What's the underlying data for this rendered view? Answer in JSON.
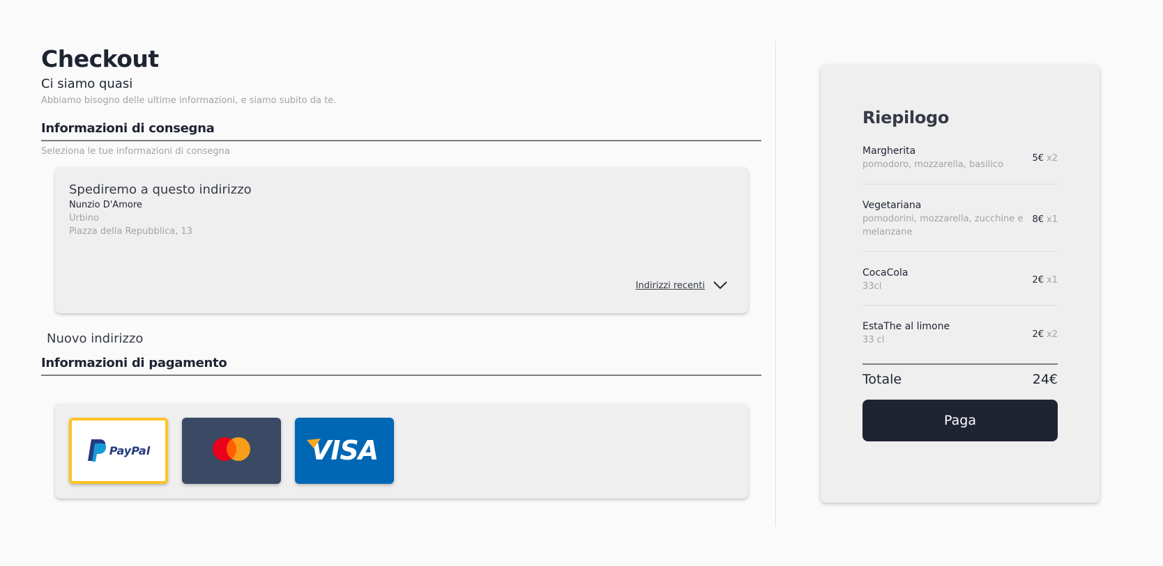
{
  "checkout": {
    "title": "Checkout",
    "subtitle": "Ci siamo quasi",
    "description": "Abbiamo bisogno delle ultime informazioni, e siamo subito da te."
  },
  "delivery": {
    "section_title": "Informazioni di consegna",
    "hint": "Seleziona le tue informazioni di consegna",
    "card_heading": "Spediremo a questo indirizzo",
    "name": "Nunzio D'Amore",
    "city": "Urbino",
    "street": "Piazza della Repubblica, 13",
    "recent_label": "Indirizzi recenti",
    "recent_icon": "chevron-down-icon",
    "new_address_label": "Nuovo indirizzo"
  },
  "payment": {
    "section_title": "Informazioni di pagamento",
    "methods": [
      {
        "id": "paypal",
        "icon": "paypal-logo-icon",
        "label": "PayPal",
        "selected": true
      },
      {
        "id": "mastercard",
        "icon": "mastercard-logo-icon",
        "label": "",
        "selected": false
      },
      {
        "id": "visa",
        "icon": "visa-logo-icon",
        "label": "VISA",
        "selected": false
      }
    ]
  },
  "summary": {
    "title": "Riepilogo",
    "items": [
      {
        "name": "Margherita",
        "desc": "pomodoro, mozzarella, basilico",
        "price": "5€",
        "qty": "x2"
      },
      {
        "name": "Vegetariana",
        "desc": "pomodorini, mozzarella, zucchine e melanzane",
        "price": "8€",
        "qty": "x1"
      },
      {
        "name": "CocaCola",
        "desc": "33cl",
        "price": "2€",
        "qty": "x1"
      },
      {
        "name": "EstaThe al limone",
        "desc": "33 cl",
        "price": "2€",
        "qty": "x2"
      }
    ],
    "total_label": "Totale",
    "total_value": "24€",
    "pay_label": "Paga"
  },
  "colors": {
    "primary_dark": "#1f2433",
    "paypal_border": "#ffc320",
    "mastercard_bg": "#3a4a65",
    "visa_bg": "#0067b4"
  }
}
